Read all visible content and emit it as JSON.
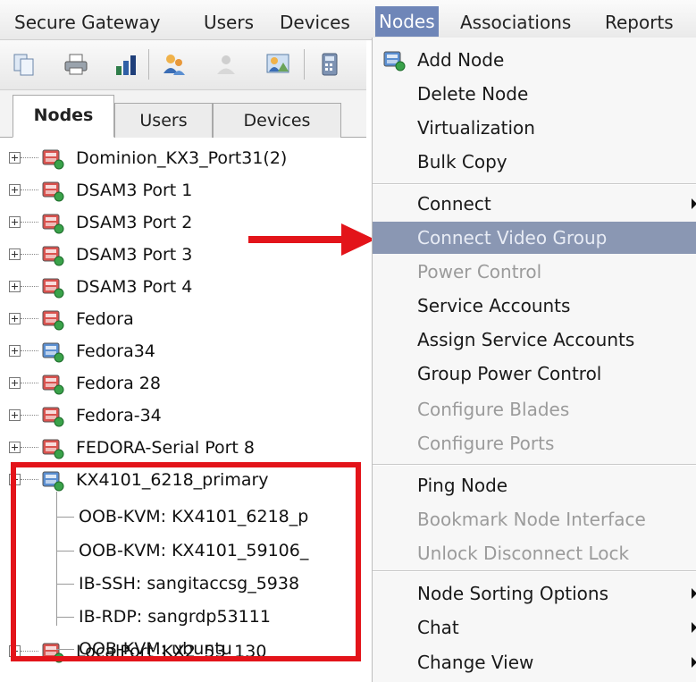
{
  "menubar": {
    "items": [
      {
        "label": "Secure Gateway"
      },
      {
        "label": "Users"
      },
      {
        "label": "Devices"
      },
      {
        "label": "Nodes"
      },
      {
        "label": "Associations"
      },
      {
        "label": "Reports"
      }
    ]
  },
  "toolbar": {
    "buttons": [
      "copy-icon",
      "print-icon",
      "chart-icon",
      "user-groups-icon",
      "user-icon-disabled",
      "image-user-icon",
      "calculator-icon"
    ]
  },
  "tabs": [
    {
      "label": "Nodes"
    },
    {
      "label": "Users"
    },
    {
      "label": "Devices"
    }
  ],
  "tree": {
    "nodes": [
      {
        "label": "Dominion_KX3_Port31(2)"
      },
      {
        "label": "DSAM3 Port 1"
      },
      {
        "label": "DSAM3 Port 2"
      },
      {
        "label": "DSAM3 Port 3"
      },
      {
        "label": "DSAM3 Port 4"
      },
      {
        "label": "Fedora"
      },
      {
        "label": "Fedora34"
      },
      {
        "label": "Fedora 28"
      },
      {
        "label": "Fedora-34"
      },
      {
        "label": "FEDORA-Serial Port 8"
      },
      {
        "label": "KX4101_6218_primary"
      },
      {
        "label": "LocalPort_KX2_53_130"
      }
    ],
    "expanded_children": [
      {
        "label": "OOB-KVM: KX4101_6218_p"
      },
      {
        "label": "OOB-KVM: KX4101_59106_"
      },
      {
        "label": "IB-SSH: sangitaccsg_5938"
      },
      {
        "label": "IB-RDP: sangrdp53111"
      },
      {
        "label": "OOB-KVM: ubuntu"
      }
    ]
  },
  "dropdown": {
    "items": [
      {
        "label": "Add Node"
      },
      {
        "label": "Delete Node"
      },
      {
        "label": "Virtualization"
      },
      {
        "label": "Bulk Copy"
      },
      {
        "label": "Connect"
      },
      {
        "label": "Connect Video Group"
      },
      {
        "label": "Power Control"
      },
      {
        "label": "Service Accounts"
      },
      {
        "label": "Assign Service Accounts"
      },
      {
        "label": "Group Power Control"
      },
      {
        "label": "Configure Blades"
      },
      {
        "label": "Configure Ports"
      },
      {
        "label": "Ping Node"
      },
      {
        "label": "Bookmark Node Interface"
      },
      {
        "label": "Unlock Disconnect Lock"
      },
      {
        "label": "Node Sorting Options"
      },
      {
        "label": "Chat"
      },
      {
        "label": "Change View"
      }
    ]
  },
  "colors": {
    "menu_active": "#6f86b8",
    "menu_highlight": "#8a97b3",
    "annotation_red": "#e3141a"
  }
}
